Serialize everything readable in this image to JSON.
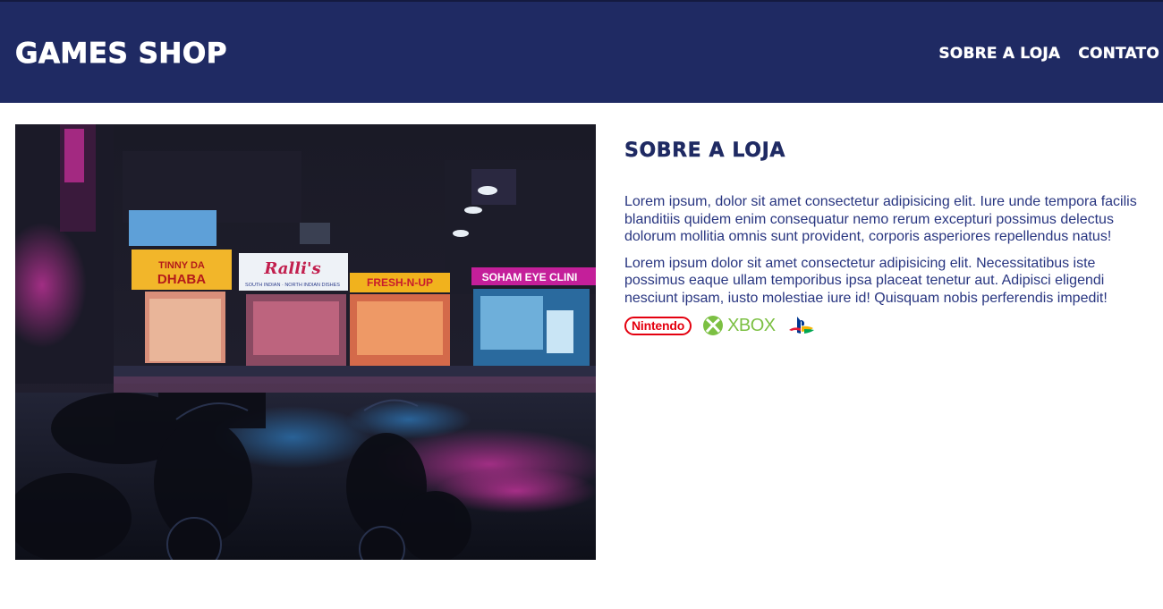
{
  "header": {
    "logo": "GAMES SHOP",
    "nav": [
      {
        "label": "SOBRE A LOJA"
      },
      {
        "label": "CONTATO"
      }
    ]
  },
  "about": {
    "title": "SOBRE A LOJA",
    "paragraphs": [
      "Lorem ipsum, dolor sit amet consectetur adipisicing elit. Iure unde tempora facilis blanditiis quidem enim consequatur nemo rerum excepturi possimus delectus dolorum mollitia omnis sunt provident, corporis asperiores repellendus natus!",
      "Lorem ipsum dolor sit amet consectetur adipisicing elit. Necessitatibus iste possimus eaque ullam temporibus ipsa placeat tenetur aut. Adipisci eligendi nesciunt ipsam, iusto molestiae iure id! Quisquam nobis perferendis impedit!"
    ],
    "brands": {
      "nintendo": "Nintendo",
      "xbox": "XBOX",
      "playstation_icon": "playstation-icon"
    }
  },
  "photo": {
    "signs": [
      "TINNY DA",
      "DHABA",
      "Ralli's",
      "SOUTH INDIAN · NORTH INDIAN DISHES",
      "FRESH-N-UP",
      "SOHAM EYE CLINI"
    ]
  },
  "colors": {
    "header_bg": "#1f2a63",
    "accent": "#1f2a63",
    "text": "#283580",
    "nintendo": "#e4000f",
    "xbox": "#7cc043"
  }
}
